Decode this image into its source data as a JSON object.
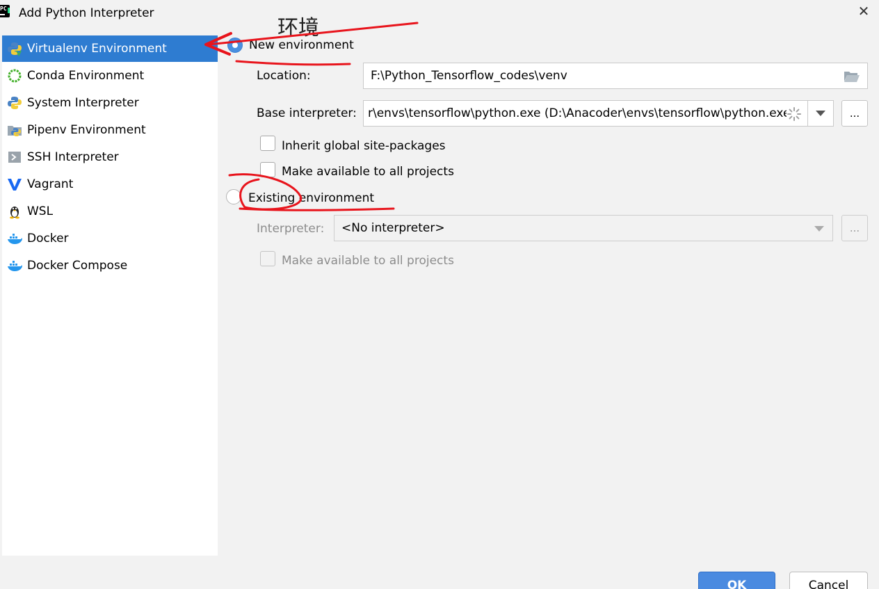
{
  "window": {
    "title": "Add Python Interpreter",
    "close_glyph": "✕"
  },
  "sidebar": {
    "items": [
      {
        "label": "Virtualenv Environment",
        "icon": "python-venv-icon"
      },
      {
        "label": "Conda Environment",
        "icon": "conda-icon"
      },
      {
        "label": "System Interpreter",
        "icon": "python-icon"
      },
      {
        "label": "Pipenv Environment",
        "icon": "pipenv-icon"
      },
      {
        "label": "SSH Interpreter",
        "icon": "ssh-icon"
      },
      {
        "label": "Vagrant",
        "icon": "vagrant-icon"
      },
      {
        "label": "WSL",
        "icon": "linux-penguin-icon"
      },
      {
        "label": "Docker",
        "icon": "docker-icon"
      },
      {
        "label": "Docker Compose",
        "icon": "docker-compose-icon"
      }
    ],
    "selected_index": 0
  },
  "new_env": {
    "radio_label": "New environment",
    "location_label": "Location:",
    "location_value": "F:\\Python_Tensorflow_codes\\venv",
    "base_label": "Base interpreter:",
    "base_value": "r\\envs\\tensorflow\\python.exe (D:\\Anacoder\\envs\\tensorflow\\python.exe)",
    "dots": "...",
    "inherit_label": "Inherit global site-packages",
    "make_available_label": "Make available to all projects"
  },
  "existing_env": {
    "radio_label": "Existing environment",
    "interpreter_label": "Interpreter:",
    "interpreter_value": "<No interpreter>",
    "dots": "...",
    "make_available_label": "Make available to all projects"
  },
  "buttons": {
    "ok": "OK",
    "cancel": "Cancel"
  },
  "annotation": {
    "text": "环境",
    "color": "#e8141c"
  }
}
